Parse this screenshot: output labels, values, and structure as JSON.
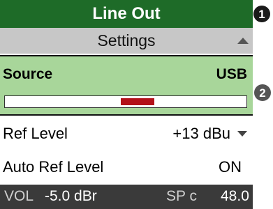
{
  "header": {
    "title": "Line Out"
  },
  "subheader": {
    "title": "Settings"
  },
  "source": {
    "label": "Source",
    "value": "USB",
    "bar": {
      "fill_start": 0.48,
      "fill_end": 0.62,
      "fill_color": "#b3111a"
    }
  },
  "rows": {
    "ref_level": {
      "label": "Ref Level",
      "value": "+13 dBu"
    },
    "auto_ref_level": {
      "label": "Auto Ref Level",
      "value": "ON"
    }
  },
  "statusbar": {
    "vol_label": "VOL",
    "vol_value": "-5.0 dBr",
    "sp_label": "SP c",
    "sp_value": "48.0"
  },
  "callouts": {
    "one": "1",
    "two": "2"
  },
  "colors": {
    "header_bg": "#1e6b28",
    "selected_bg": "#a8d69a",
    "subheader_bg": "#c7c7c7",
    "status_bg": "#3a3a3a"
  },
  "icons": {
    "scroll_up": "triangle-up-icon",
    "dropdown": "chevron-down-icon"
  }
}
